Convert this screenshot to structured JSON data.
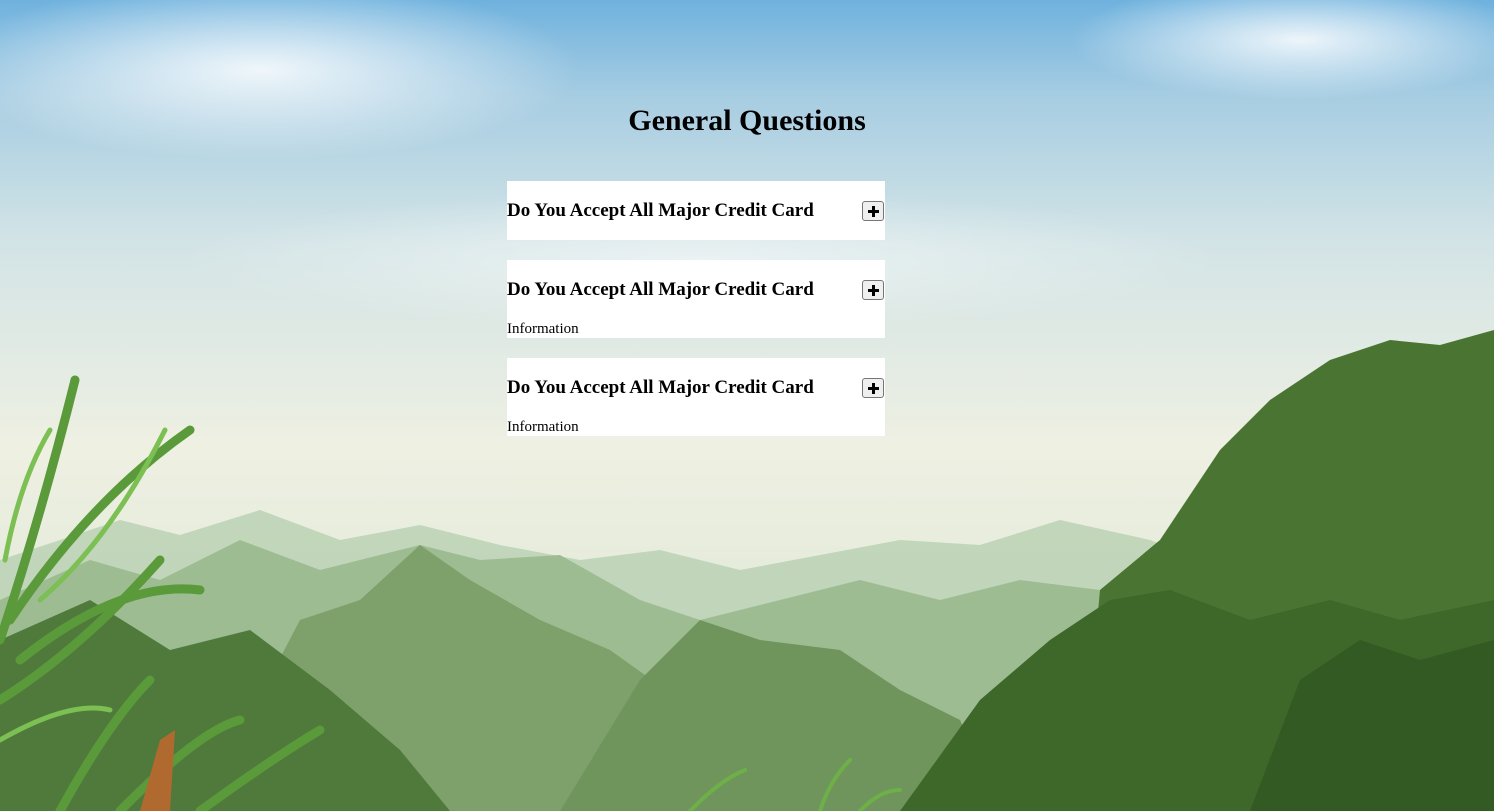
{
  "page": {
    "title": "General Questions"
  },
  "faq": {
    "items": [
      {
        "question": "Do You Accept All Major Credit Card",
        "answer": "",
        "expanded": false,
        "toggle_icon": "plus-icon"
      },
      {
        "question": "Do You Accept All Major Credit Card",
        "answer": "Information",
        "expanded": true,
        "toggle_icon": "plus-icon"
      },
      {
        "question": "Do You Accept All Major Credit Card",
        "answer": "Information",
        "expanded": true,
        "toggle_icon": "plus-icon"
      }
    ]
  },
  "colors": {
    "card_background": "#ffffff",
    "text": "#000000",
    "button_background": "#efefef",
    "button_border": "#767676"
  }
}
